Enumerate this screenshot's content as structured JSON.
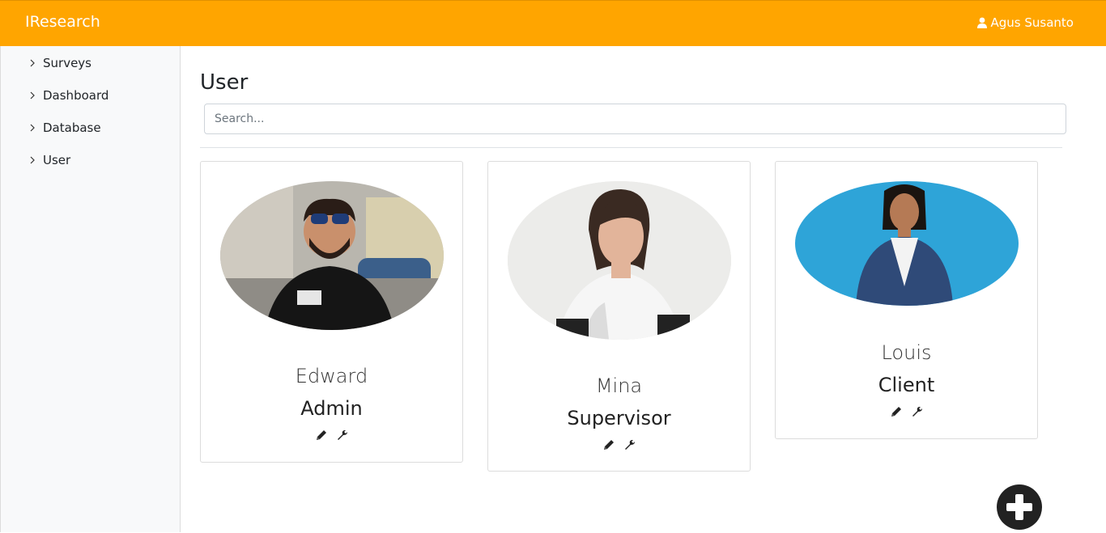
{
  "app": {
    "brand": "IResearch",
    "user_name": "Agus Susanto"
  },
  "sidebar": {
    "items": [
      {
        "label": "Surveys"
      },
      {
        "label": "Dashboard"
      },
      {
        "label": "Database"
      },
      {
        "label": "User"
      }
    ]
  },
  "main": {
    "title": "User",
    "search": {
      "placeholder": "Search..."
    }
  },
  "users": [
    {
      "name": "Edward",
      "role": "Admin"
    },
    {
      "name": "Mina",
      "role": "Supervisor"
    },
    {
      "name": "Louis",
      "role": "Client"
    }
  ],
  "colors": {
    "accent": "#ffa500",
    "fab": "#222222"
  },
  "icons": {
    "user": "user-icon",
    "edit": "pencil-icon",
    "settings": "wrench-icon",
    "add": "plus-circle-icon",
    "chevron": "chevron-right-icon"
  }
}
